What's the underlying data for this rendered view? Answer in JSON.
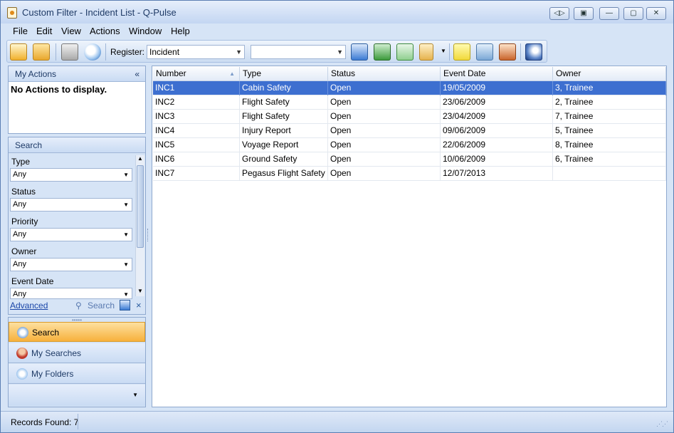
{
  "window": {
    "title": "Custom Filter - Incident List - Q-Pulse"
  },
  "menu": [
    "File",
    "Edit",
    "View",
    "Actions",
    "Window",
    "Help"
  ],
  "toolbar": {
    "register_label": "Register:",
    "register_value": "Incident",
    "second_value": ""
  },
  "my_actions": {
    "title": "My Actions",
    "collapse": "«",
    "empty_text": "No Actions to display."
  },
  "search_panel": {
    "title": "Search",
    "fields": [
      {
        "label": "Type",
        "value": "Any"
      },
      {
        "label": "Status",
        "value": "Any"
      },
      {
        "label": "Priority",
        "value": "Any"
      },
      {
        "label": "Owner",
        "value": "Any"
      },
      {
        "label": "Event Date",
        "value": "Any"
      }
    ],
    "advanced": "Advanced",
    "search": "Search",
    "clear": "×"
  },
  "nav": [
    {
      "label": "Search"
    },
    {
      "label": "My Searches"
    },
    {
      "label": "My Folders"
    }
  ],
  "grid": {
    "columns": [
      "Number",
      "Type",
      "Status",
      "Event Date",
      "Owner"
    ],
    "sort_indicator": "▲",
    "rows": [
      [
        "INC1",
        "Cabin Safety",
        "Open",
        "19/05/2009",
        "3, Trainee"
      ],
      [
        "INC2",
        "Flight Safety",
        "Open",
        "23/06/2009",
        "2, Trainee"
      ],
      [
        "INC3",
        "Flight Safety",
        "Open",
        "23/04/2009",
        "7, Trainee"
      ],
      [
        "INC4",
        "Injury Report",
        "Open",
        "09/06/2009",
        "5, Trainee"
      ],
      [
        "INC5",
        "Voyage Report",
        "Open",
        "22/06/2009",
        "8, Trainee"
      ],
      [
        "INC6",
        "Ground Safety",
        "Open",
        "10/06/2009",
        "6, Trainee"
      ],
      [
        "INC7",
        "Pegasus Flight Safety",
        "Open",
        "12/07/2013",
        ""
      ]
    ]
  },
  "status": {
    "records_found": "Records Found: 7"
  },
  "colors": {
    "selection": "#3d6fd0",
    "active_nav": "#f7b13c"
  }
}
